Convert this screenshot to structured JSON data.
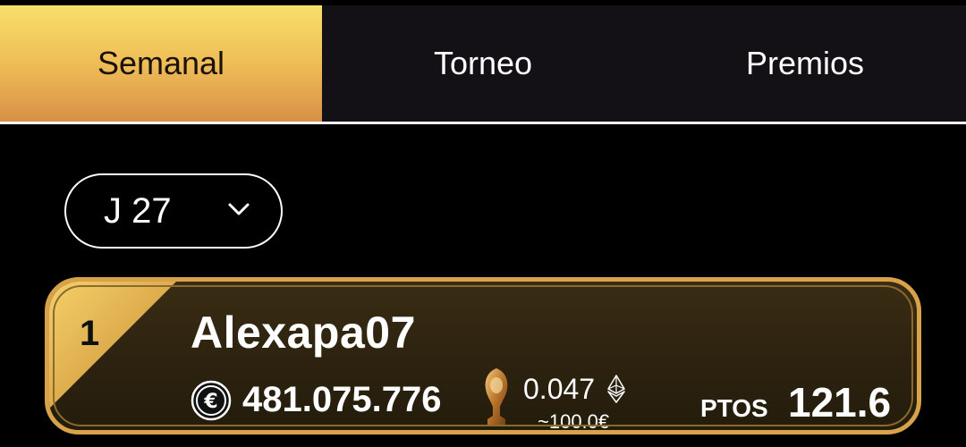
{
  "tabs": [
    {
      "label": "Semanal",
      "active": true
    },
    {
      "label": "Torneo",
      "active": false
    },
    {
      "label": "Premios",
      "active": false
    }
  ],
  "selector": {
    "value": "J 27",
    "icon": "chevron-down-icon"
  },
  "ranking": [
    {
      "rank": "1",
      "username": "Alexapa07",
      "coins": "481.075.776",
      "prize_eth": "0.047",
      "prize_eur": "~100.0€",
      "pts_label": "PTOS",
      "points": "121.6"
    }
  ],
  "colors": {
    "accent_gold": "#d8a24a",
    "tab_active_top": "#f7df6a",
    "tab_active_bottom": "#d79047",
    "tab_bar_bg": "#131116",
    "card_bg": "#2c220f"
  }
}
